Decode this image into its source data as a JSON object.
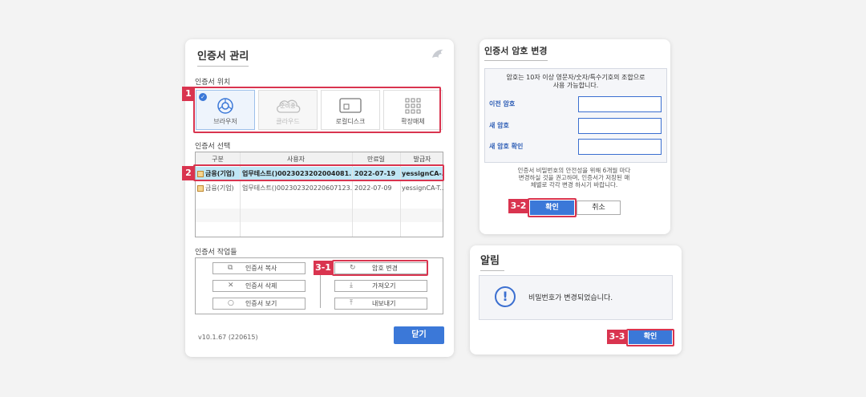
{
  "cert_manager": {
    "title": "인증서 관리",
    "location_label": "인증서 위치",
    "locations": [
      {
        "label": "브라우저",
        "icon": "browser-icon",
        "selected": true
      },
      {
        "label": "클라우드",
        "icon": "cloud-icon",
        "badge": "준비중",
        "disabled": true
      },
      {
        "label": "로컬디스크",
        "icon": "disk-icon"
      },
      {
        "label": "확장매체",
        "icon": "grid-icon"
      }
    ],
    "select_label": "인증서 선택",
    "columns": [
      "구분",
      "사용자",
      "만료일",
      "발급자"
    ],
    "rows": [
      {
        "type": "금융(기업)",
        "user": "업무테스트()0023023202004081...",
        "expiry": "2022-07-19",
        "issuer": "yessignCA-...",
        "selected": true
      },
      {
        "type": "금융(기업)",
        "user": "업무테스트()002302320220607123...",
        "expiry": "2022-07-09",
        "issuer": "yessignCA-T..."
      }
    ],
    "tasks_label": "인증서 작업들",
    "tasks_left": [
      {
        "label": "인증서 복사",
        "icon": "copy-icon"
      },
      {
        "label": "인증서 삭제",
        "icon": "delete-icon"
      },
      {
        "label": "인증서 보기",
        "icon": "search-icon"
      }
    ],
    "tasks_right": [
      {
        "label": "암호 변경",
        "icon": "refresh-icon"
      },
      {
        "label": "가져오기",
        "icon": "download-icon"
      },
      {
        "label": "내보내기",
        "icon": "upload-icon"
      }
    ],
    "version": "v10.1.67 (220615)",
    "close_label": "닫기"
  },
  "pw_change": {
    "title": "인증서 암호 변경",
    "rule": "암호는 10자 이상 영문자/숫자/특수기호의 조합으로\n사용 가능합니다.",
    "fields": [
      "이전 암호",
      "새 암호",
      "새 암호 확인"
    ],
    "notice": "인증서 비밀번호의 안전성을 위해 6개월 마다\n변경하실 것을 권고하며, 인증서가 저장된 매\n체별로 각각 변경 하시기 바랍니다.",
    "ok_label": "확인",
    "cancel_label": "취소"
  },
  "alert": {
    "title": "알림",
    "message": "비밀번호가 변경되었습니다.",
    "ok_label": "확인"
  },
  "steps": [
    "1",
    "2",
    "3-1",
    "3-2",
    "3-3"
  ],
  "colors": {
    "accent": "#3b78d8",
    "highlight": "#d9344f",
    "selected_row": "#bfe6f5"
  }
}
